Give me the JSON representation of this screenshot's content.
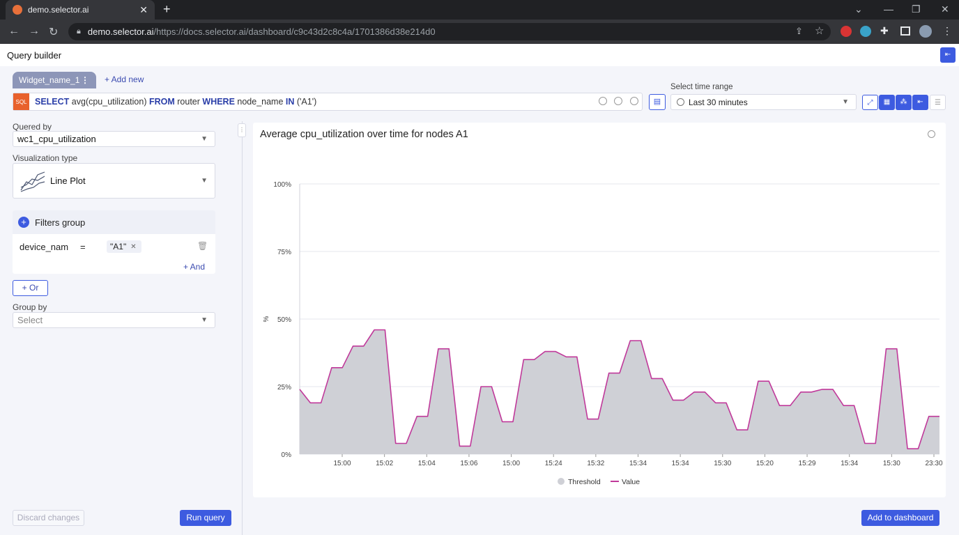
{
  "browser": {
    "tab_title": "demo.selector.ai",
    "tab_close": "✕",
    "new_tab": "+",
    "url_domain": "demo.selector.ai",
    "url_path": "/https://docs.selector.ai/dashboard/c9c43d2c8c4a/1701386d38e214d0"
  },
  "app": {
    "header_title": "Query builder",
    "widget_tab": "Widget_name_1",
    "add_new": "+ Add new",
    "query": {
      "badge": "SQL",
      "kw_select": "SELECT",
      "part1": " avg(cpu_utilization) ",
      "kw_from": "FROM",
      "part2": " router ",
      "kw_where": "WHERE",
      "part3": " node_name ",
      "kw_in": "IN",
      "part4": " ('A1')"
    },
    "time_range_label": "Select time range",
    "time_range_value": "Last 30 minutes"
  },
  "left_panel": {
    "queried_by_label": "Quered by",
    "queried_by_value": "wc1_cpu_utilization",
    "viz_label": "Visualization type",
    "viz_value": "Line Plot",
    "filters_group_title": "Filters group",
    "filter_field": "device_nam",
    "filter_op": "=",
    "filter_value": "\"A1\"",
    "and_label": "+ And",
    "or_label": "+ Or",
    "group_by_label": "Group by",
    "group_by_placeholder": "Select",
    "discard_label": "Discard changes",
    "run_label": "Run query"
  },
  "add_dashboard_label": "Add to dashboard",
  "colors": {
    "accent": "#3d5be0",
    "value_line": "#c0399a",
    "threshold_fill": "#cfd0d6",
    "sql_badge": "#e8612c"
  },
  "chart_data": {
    "type": "area",
    "title": "Average cpu_utilization over time for nodes A1",
    "ylabel": "%",
    "ylim": [
      0,
      100
    ],
    "yticks": [
      "0%",
      "25%",
      "50%",
      "75%",
      "100%"
    ],
    "xticks": [
      "15:00",
      "15:02",
      "15:04",
      "15:06",
      "15:00",
      "15:24",
      "15:32",
      "15:34",
      "15:34",
      "15:30",
      "15:20",
      "15:29",
      "15:34",
      "15:30",
      "23:30"
    ],
    "grid": true,
    "legend_position": "bottom",
    "series": [
      {
        "name": "Threshold",
        "style": "area",
        "values": [
          24,
          19,
          19,
          32,
          32,
          40,
          40,
          46,
          46,
          4,
          4,
          14,
          14,
          39,
          39,
          3,
          3,
          25,
          25,
          12,
          12,
          35,
          35,
          38,
          38,
          36,
          36,
          13,
          13,
          30,
          30,
          42,
          42,
          28,
          28,
          20,
          20,
          23,
          23,
          19,
          19,
          9,
          9,
          27,
          27,
          18,
          18,
          23,
          23,
          24,
          24,
          18,
          18,
          4,
          4,
          39,
          39,
          2,
          2,
          14,
          14
        ]
      },
      {
        "name": "Value",
        "style": "line",
        "values": [
          24,
          19,
          19,
          32,
          32,
          40,
          40,
          46,
          46,
          4,
          4,
          14,
          14,
          39,
          39,
          3,
          3,
          25,
          25,
          12,
          12,
          35,
          35,
          38,
          38,
          36,
          36,
          13,
          13,
          30,
          30,
          42,
          42,
          28,
          28,
          20,
          20,
          23,
          23,
          19,
          19,
          9,
          9,
          27,
          27,
          18,
          18,
          23,
          23,
          24,
          24,
          18,
          18,
          4,
          4,
          39,
          39,
          2,
          2,
          14,
          14
        ]
      }
    ]
  }
}
